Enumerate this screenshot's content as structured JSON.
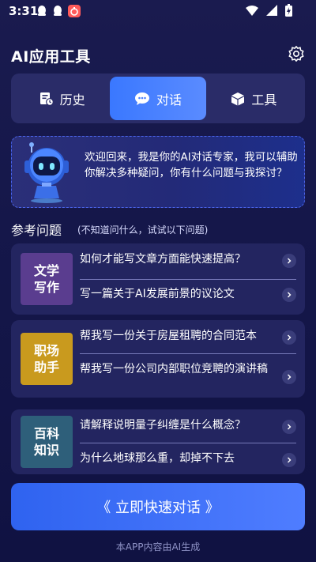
{
  "status_bar": {
    "time": "3:31",
    "left_icons": [
      "qq-icon",
      "qq-icon",
      "app-notification-icon"
    ],
    "right_icons": [
      "wifi-icon",
      "signal-icon",
      "battery-icon"
    ]
  },
  "header": {
    "title": "AI应用工具",
    "settings_icon": "gear-icon"
  },
  "tabs": [
    {
      "label": "历史",
      "icon": "history-icon",
      "active": false
    },
    {
      "label": "对话",
      "icon": "chat-bubble-icon",
      "active": true
    },
    {
      "label": "工具",
      "icon": "cube-icon",
      "active": false
    }
  ],
  "welcome": {
    "text": "欢迎回来，我是你的AI对话专家，我可以辅助你解决多种疑问，你有什么问题与我探讨？"
  },
  "section": {
    "title": "参考问题",
    "hint": "(不知道问什么，试试以下问题)"
  },
  "cards": [
    {
      "category": "文学写作",
      "thumb_color": "#5a3d8f",
      "questions": [
        "如何才能写文章方面能快速提高？",
        "写一篇关于AI发展前景的议论文"
      ]
    },
    {
      "category": "职场助手",
      "thumb_color": "#c99a1e",
      "questions": [
        "帮我写一份关于房屋租聘的合同范本",
        "帮我写一份公司内部职位竞聘的演讲稿"
      ]
    },
    {
      "category": "百科知识",
      "thumb_color": "#2e5f7a",
      "questions": [
        "请解释说明量子纠缠是什么概念？",
        "为什么地球那么重，却掉不下去"
      ]
    }
  ],
  "cta": {
    "label": "《 立即快速对话 》"
  },
  "footer": "本APP内容由AI生成",
  "colors": {
    "accent": "#3a78ff",
    "card_bg": "#232560",
    "page_bg": "#15174a"
  }
}
